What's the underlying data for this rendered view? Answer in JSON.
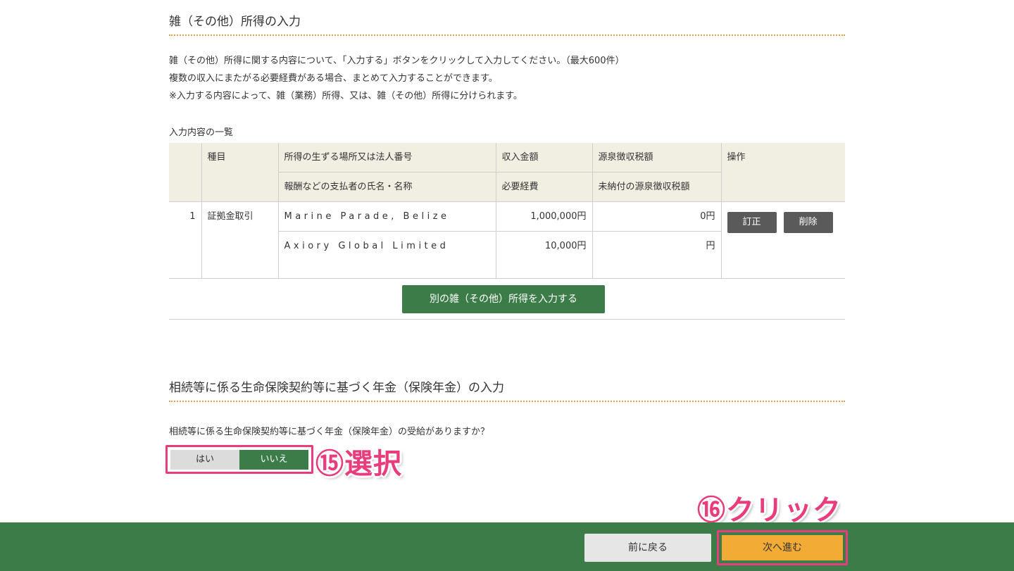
{
  "section1": {
    "title": "雑（その他）所得の入力",
    "desc_lines": [
      "雑（その他）所得に関する内容について、「入力する」ボタンをクリックして入力してください。（最大600件）",
      "複数の収入にまたがる必要経費がある場合、まとめて入力することができます。",
      "※入力する内容によって、雑（業務）所得、又は、雑（その他）所得に分けられます。"
    ],
    "list_caption": "入力内容の一覧",
    "headers": {
      "type": "種目",
      "place": "所得の生ずる場所又は法人番号",
      "payer": "報酬などの支払者の氏名・名称",
      "income": "収入金額",
      "expense": "必要経費",
      "withholding": "源泉徴収税額",
      "unpaid_withholding": "未納付の源泉徴収税額",
      "ops": "操作"
    },
    "rows": [
      {
        "no": "1",
        "type": "証拠金取引",
        "place": "Marine Parade, Belize",
        "payer": "Axiory Global Limited",
        "income": "1,000,000円",
        "expense": "10,000円",
        "withholding": "0円",
        "unpaid_withholding": "円",
        "edit_label": "訂正",
        "delete_label": "削除"
      }
    ],
    "add_button": "別の雑（その他）所得を入力する"
  },
  "section2": {
    "title": "相続等に係る生命保険契約等に基づく年金（保険年金）の入力",
    "question": "相続等に係る生命保険契約等に基づく年金（保険年金）の受給がありますか？",
    "options": {
      "yes": "はい",
      "no": "いいえ"
    },
    "selected": "いいえ"
  },
  "annotations": {
    "step15": "⑮選択",
    "step16": "⑯クリック"
  },
  "footer": {
    "back_label": "前に戻る",
    "next_label": "次へ進む"
  },
  "colors": {
    "accent_green": "#3c7c48",
    "header_bg": "#f1eee2",
    "next_orange": "#f2ac35",
    "highlight_pink": "#e83c7c",
    "dotted_rule": "#d9a441"
  }
}
